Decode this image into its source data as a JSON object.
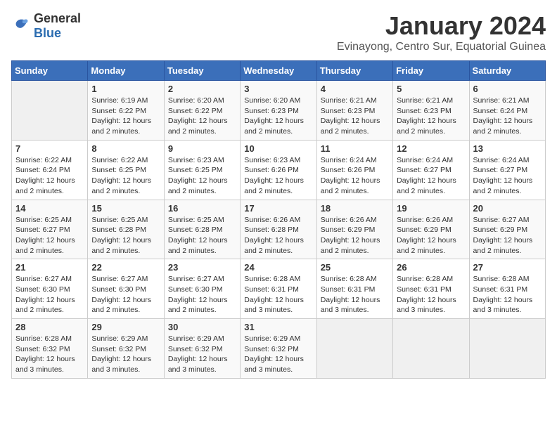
{
  "logo": {
    "general": "General",
    "blue": "Blue"
  },
  "header": {
    "title": "January 2024",
    "subtitle": "Evinayong, Centro Sur, Equatorial Guinea"
  },
  "weekdays": [
    "Sunday",
    "Monday",
    "Tuesday",
    "Wednesday",
    "Thursday",
    "Friday",
    "Saturday"
  ],
  "weeks": [
    [
      {
        "day": "",
        "info": ""
      },
      {
        "day": "1",
        "info": "Sunrise: 6:19 AM\nSunset: 6:22 PM\nDaylight: 12 hours\nand 2 minutes."
      },
      {
        "day": "2",
        "info": "Sunrise: 6:20 AM\nSunset: 6:22 PM\nDaylight: 12 hours\nand 2 minutes."
      },
      {
        "day": "3",
        "info": "Sunrise: 6:20 AM\nSunset: 6:23 PM\nDaylight: 12 hours\nand 2 minutes."
      },
      {
        "day": "4",
        "info": "Sunrise: 6:21 AM\nSunset: 6:23 PM\nDaylight: 12 hours\nand 2 minutes."
      },
      {
        "day": "5",
        "info": "Sunrise: 6:21 AM\nSunset: 6:23 PM\nDaylight: 12 hours\nand 2 minutes."
      },
      {
        "day": "6",
        "info": "Sunrise: 6:21 AM\nSunset: 6:24 PM\nDaylight: 12 hours\nand 2 minutes."
      }
    ],
    [
      {
        "day": "7",
        "info": "Sunrise: 6:22 AM\nSunset: 6:24 PM\nDaylight: 12 hours\nand 2 minutes."
      },
      {
        "day": "8",
        "info": "Sunrise: 6:22 AM\nSunset: 6:25 PM\nDaylight: 12 hours\nand 2 minutes."
      },
      {
        "day": "9",
        "info": "Sunrise: 6:23 AM\nSunset: 6:25 PM\nDaylight: 12 hours\nand 2 minutes."
      },
      {
        "day": "10",
        "info": "Sunrise: 6:23 AM\nSunset: 6:26 PM\nDaylight: 12 hours\nand 2 minutes."
      },
      {
        "day": "11",
        "info": "Sunrise: 6:24 AM\nSunset: 6:26 PM\nDaylight: 12 hours\nand 2 minutes."
      },
      {
        "day": "12",
        "info": "Sunrise: 6:24 AM\nSunset: 6:27 PM\nDaylight: 12 hours\nand 2 minutes."
      },
      {
        "day": "13",
        "info": "Sunrise: 6:24 AM\nSunset: 6:27 PM\nDaylight: 12 hours\nand 2 minutes."
      }
    ],
    [
      {
        "day": "14",
        "info": "Sunrise: 6:25 AM\nSunset: 6:27 PM\nDaylight: 12 hours\nand 2 minutes."
      },
      {
        "day": "15",
        "info": "Sunrise: 6:25 AM\nSunset: 6:28 PM\nDaylight: 12 hours\nand 2 minutes."
      },
      {
        "day": "16",
        "info": "Sunrise: 6:25 AM\nSunset: 6:28 PM\nDaylight: 12 hours\nand 2 minutes."
      },
      {
        "day": "17",
        "info": "Sunrise: 6:26 AM\nSunset: 6:28 PM\nDaylight: 12 hours\nand 2 minutes."
      },
      {
        "day": "18",
        "info": "Sunrise: 6:26 AM\nSunset: 6:29 PM\nDaylight: 12 hours\nand 2 minutes."
      },
      {
        "day": "19",
        "info": "Sunrise: 6:26 AM\nSunset: 6:29 PM\nDaylight: 12 hours\nand 2 minutes."
      },
      {
        "day": "20",
        "info": "Sunrise: 6:27 AM\nSunset: 6:29 PM\nDaylight: 12 hours\nand 2 minutes."
      }
    ],
    [
      {
        "day": "21",
        "info": "Sunrise: 6:27 AM\nSunset: 6:30 PM\nDaylight: 12 hours\nand 2 minutes."
      },
      {
        "day": "22",
        "info": "Sunrise: 6:27 AM\nSunset: 6:30 PM\nDaylight: 12 hours\nand 2 minutes."
      },
      {
        "day": "23",
        "info": "Sunrise: 6:27 AM\nSunset: 6:30 PM\nDaylight: 12 hours\nand 2 minutes."
      },
      {
        "day": "24",
        "info": "Sunrise: 6:28 AM\nSunset: 6:31 PM\nDaylight: 12 hours\nand 3 minutes."
      },
      {
        "day": "25",
        "info": "Sunrise: 6:28 AM\nSunset: 6:31 PM\nDaylight: 12 hours\nand 3 minutes."
      },
      {
        "day": "26",
        "info": "Sunrise: 6:28 AM\nSunset: 6:31 PM\nDaylight: 12 hours\nand 3 minutes."
      },
      {
        "day": "27",
        "info": "Sunrise: 6:28 AM\nSunset: 6:31 PM\nDaylight: 12 hours\nand 3 minutes."
      }
    ],
    [
      {
        "day": "28",
        "info": "Sunrise: 6:28 AM\nSunset: 6:32 PM\nDaylight: 12 hours\nand 3 minutes."
      },
      {
        "day": "29",
        "info": "Sunrise: 6:29 AM\nSunset: 6:32 PM\nDaylight: 12 hours\nand 3 minutes."
      },
      {
        "day": "30",
        "info": "Sunrise: 6:29 AM\nSunset: 6:32 PM\nDaylight: 12 hours\nand 3 minutes."
      },
      {
        "day": "31",
        "info": "Sunrise: 6:29 AM\nSunset: 6:32 PM\nDaylight: 12 hours\nand 3 minutes."
      },
      {
        "day": "",
        "info": ""
      },
      {
        "day": "",
        "info": ""
      },
      {
        "day": "",
        "info": ""
      }
    ]
  ]
}
